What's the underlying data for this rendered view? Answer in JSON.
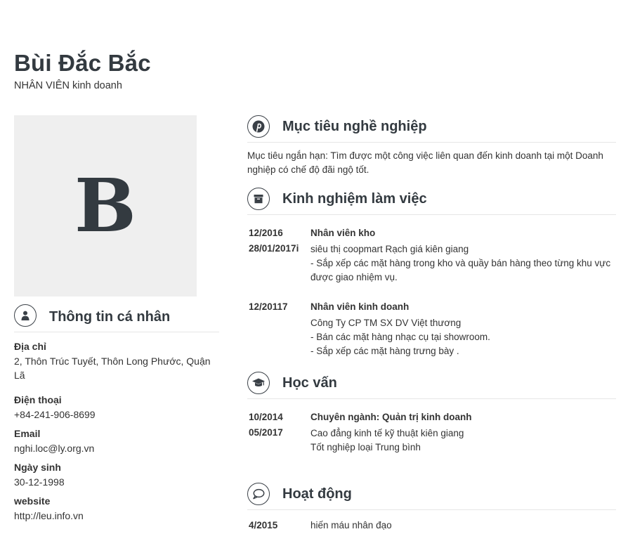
{
  "profile": {
    "name": "Bùi Đắc Bắc",
    "title": "NHÂN VIÊN kinh doanh",
    "avatar_letter": "B"
  },
  "personal": {
    "heading": "Thông tin cá nhân",
    "icon": "user-icon",
    "fields": [
      {
        "label": "Địa chỉ",
        "value": "2, Thôn Trúc Tuyết, Thôn Long Phước, Quận Lã"
      },
      {
        "label": "Điện thoại",
        "value": "+84-241-906-8699"
      },
      {
        "label": "Email",
        "value": "nghi.loc@ly.org.vn"
      },
      {
        "label": "Ngày sinh",
        "value": "30-12-1998"
      },
      {
        "label": "website",
        "value": "http://leu.info.vn"
      }
    ]
  },
  "objective": {
    "heading": "Mục tiêu nghề nghiệp",
    "icon": "pinterest-icon",
    "text": "Mục tiêu ngắn hạn: Tìm được một công việc liên quan đến kinh doanh tại một Doanh nghiệp có chế độ đãi ngộ tốt."
  },
  "experience": {
    "heading": "Kinh nghiệm làm việc",
    "icon": "archive-box-icon",
    "items": [
      {
        "from": "12/2016",
        "to": "28/01/2017i",
        "title": "Nhân viên kho",
        "line1": "siêu thị coopmart Rạch giá kiên giang",
        "line2": "- Sắp xếp các mặt hàng trong kho và quầy bán hàng theo từng khu vực được giao nhiệm vụ.",
        "line3": ""
      },
      {
        "from": "12/20117",
        "to": "",
        "title": "Nhân viên kinh doanh",
        "line1": "Công Ty CP TM SX DV Việt thương",
        "line2": "- Bán các mặt hàng nhạc cụ tại showroom.",
        "line3": "- Sắp xếp các mặt hàng trưng bày ."
      }
    ]
  },
  "education": {
    "heading": "Học vấn",
    "icon": "graduation-cap-icon",
    "items": [
      {
        "from": "10/2014",
        "to": "05/2017",
        "title": "Chuyên ngành: Quản trị kinh  doanh",
        "line1": "Cao đẳng kinh tế  kỹ thuật kiên giang",
        "line2": "Tốt nghiệp loại Trung bình"
      }
    ]
  },
  "activities": {
    "heading": "Hoạt động",
    "icon": "speech-bubble-icon",
    "items": [
      {
        "from": "4/2015",
        "title": "hiến máu nhân đạo"
      }
    ]
  }
}
